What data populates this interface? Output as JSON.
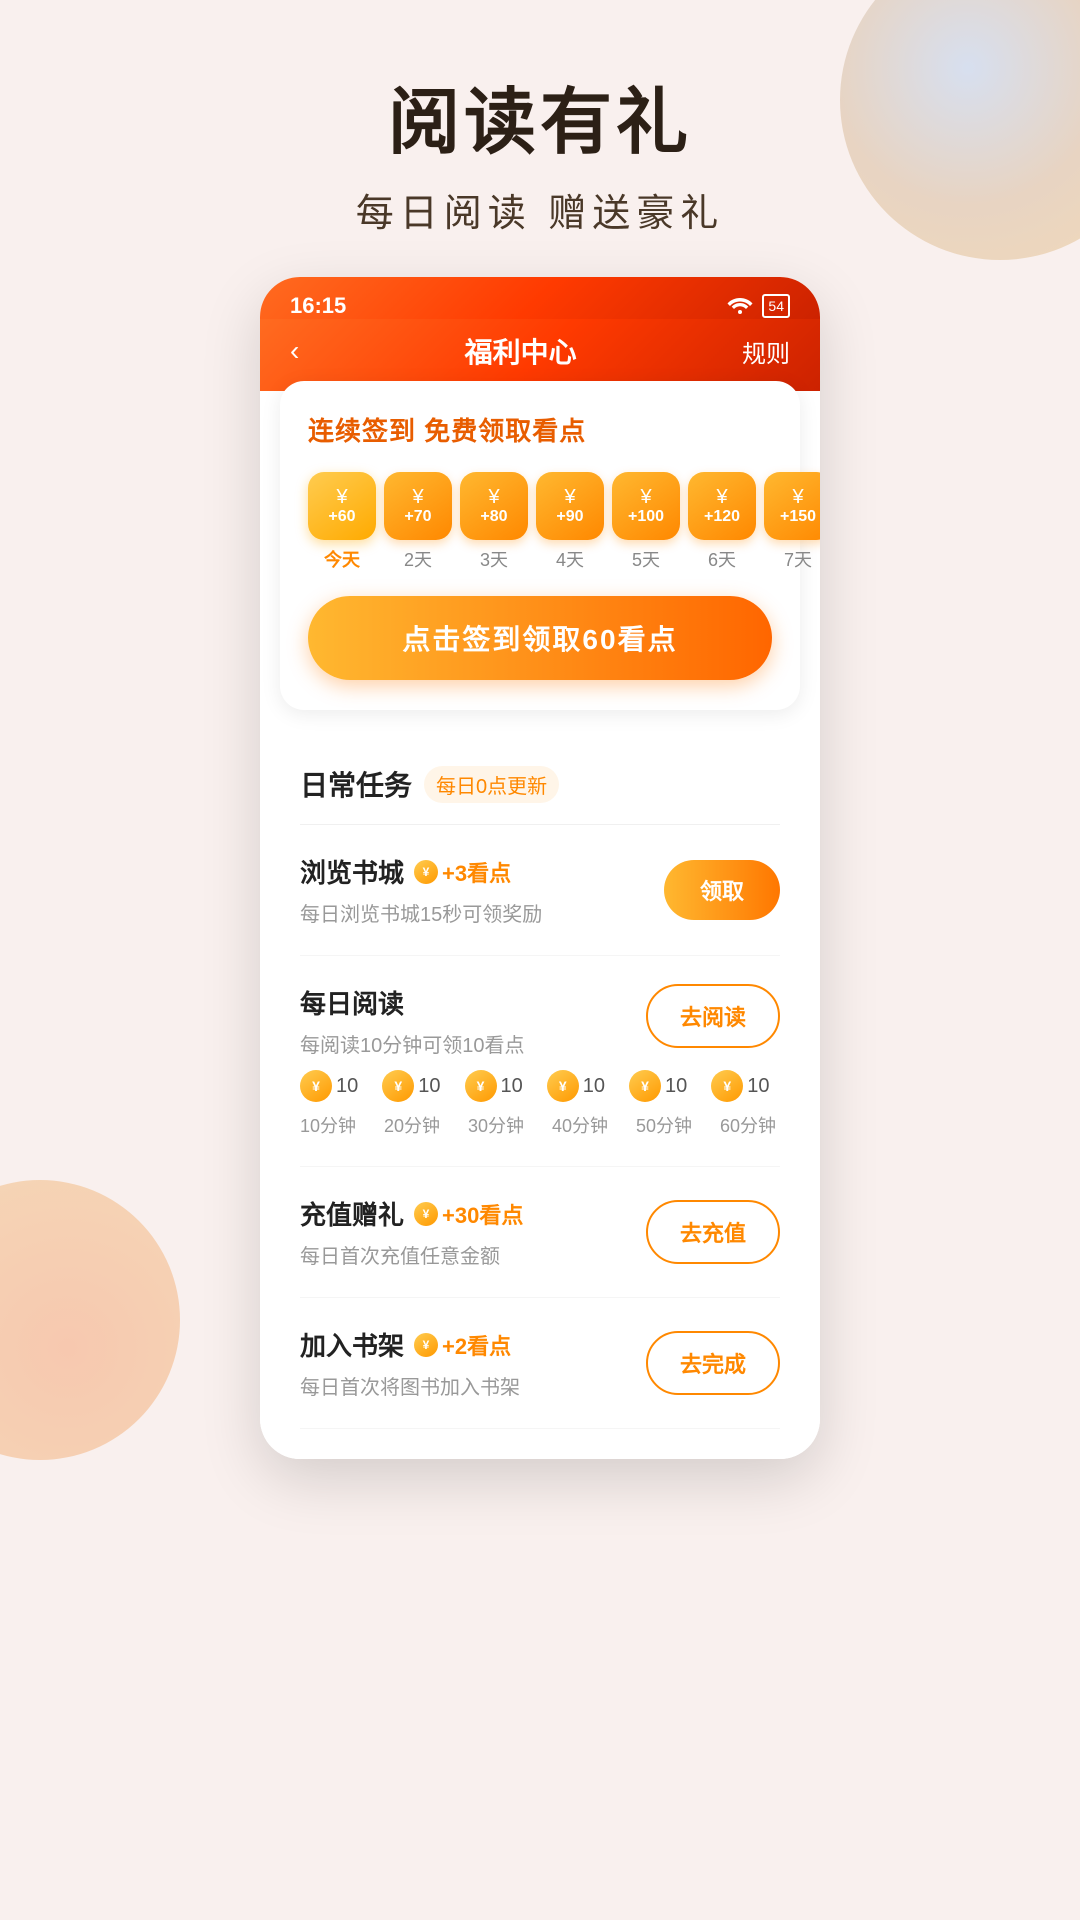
{
  "header": {
    "title": "阅读有礼",
    "subtitle": "每日阅读  赠送豪礼"
  },
  "statusBar": {
    "time": "16:15",
    "battery": "54"
  },
  "navBar": {
    "back": "‹",
    "title": "福利中心",
    "rules": "规则"
  },
  "signinCard": {
    "title": "连续签到 免费领取看点",
    "days": [
      {
        "amount": "+60",
        "label": "今天",
        "isToday": true
      },
      {
        "amount": "+70",
        "label": "2天",
        "isToday": false
      },
      {
        "amount": "+80",
        "label": "3天",
        "isToday": false
      },
      {
        "amount": "+90",
        "label": "4天",
        "isToday": false
      },
      {
        "amount": "+100",
        "label": "5天",
        "isToday": false
      },
      {
        "amount": "+120",
        "label": "6天",
        "isToday": false
      },
      {
        "amount": "+150",
        "label": "7天",
        "isToday": false
      }
    ],
    "ctaButton": "点击签到领取60看点"
  },
  "tasksSection": {
    "title": "日常任务",
    "updateNote": "每日0点更新",
    "tasks": [
      {
        "name": "浏览书城",
        "points": "+3看点",
        "desc": "每日浏览书城15秒可领奖励",
        "btnLabel": "领取",
        "btnFilled": true,
        "hasProgressCoins": false
      },
      {
        "name": "每日阅读",
        "points": "",
        "desc": "每阅读10分钟可领10看点",
        "btnLabel": "去阅读",
        "btnFilled": false,
        "hasProgressCoins": true,
        "progressCoins": [
          "10",
          "10",
          "10",
          "10",
          "10",
          "10"
        ],
        "progressTimes": [
          "10分钟",
          "20分钟",
          "30分钟",
          "40分钟",
          "50分钟",
          "60分钟"
        ]
      },
      {
        "name": "充值赠礼",
        "points": "+30看点",
        "desc": "每日首次充值任意金额",
        "btnLabel": "去充值",
        "btnFilled": false,
        "hasProgressCoins": false
      },
      {
        "name": "加入书架",
        "points": "+2看点",
        "desc": "每日首次将图书加入书架",
        "btnLabel": "去完成",
        "btnFilled": false,
        "hasProgressCoins": false
      }
    ]
  },
  "icons": {
    "yuan": "¥",
    "wifi": "WiFi",
    "coinSymbol": "¥"
  }
}
